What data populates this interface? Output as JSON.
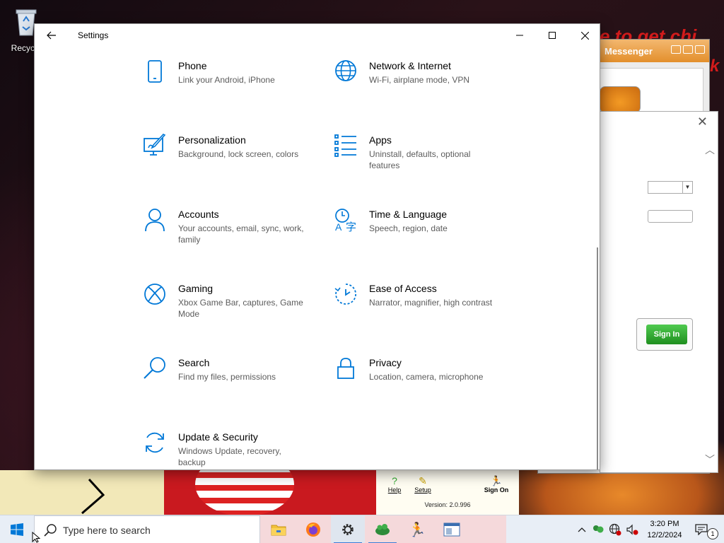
{
  "desktop": {
    "recycle_bin_label": "Recycle",
    "accent": "#0078d7"
  },
  "aim": {
    "title": "Messenger",
    "heading_text": "e to get chi",
    "heading_text_2": "k",
    "sign_in_label": "Sign In",
    "tools": [
      {
        "label": "Help",
        "icon": "help-icon"
      },
      {
        "label": "Setup",
        "icon": "setup-icon"
      },
      {
        "label": "Sign On",
        "icon": "running-man-icon"
      }
    ],
    "version": "Version: 2.0.996"
  },
  "settings": {
    "title": "Settings",
    "tiles": [
      {
        "title": "Phone",
        "desc": "Link your Android, iPhone",
        "icon": "phone-icon"
      },
      {
        "title": "Network & Internet",
        "desc": "Wi-Fi, airplane mode, VPN",
        "icon": "globe-icon"
      },
      {
        "title": "Personalization",
        "desc": "Background, lock screen, colors",
        "icon": "paint-brush-icon"
      },
      {
        "title": "Apps",
        "desc": "Uninstall, defaults, optional features",
        "icon": "apps-list-icon"
      },
      {
        "title": "Accounts",
        "desc": "Your accounts, email, sync, work, family",
        "icon": "person-icon"
      },
      {
        "title": "Time & Language",
        "desc": "Speech, region, date",
        "icon": "time-language-icon"
      },
      {
        "title": "Gaming",
        "desc": "Xbox Game Bar, captures, Game Mode",
        "icon": "xbox-icon"
      },
      {
        "title": "Ease of Access",
        "desc": "Narrator, magnifier, high contrast",
        "icon": "ease-of-access-icon"
      },
      {
        "title": "Search",
        "desc": "Find my files, permissions",
        "icon": "search-icon"
      },
      {
        "title": "Privacy",
        "desc": "Location, camera, microphone",
        "icon": "lock-icon"
      },
      {
        "title": "Update & Security",
        "desc": "Windows Update, recovery, backup",
        "icon": "sync-icon"
      }
    ]
  },
  "taskbar": {
    "search_placeholder": "Type here to search",
    "apps": [
      "file-explorer-icon",
      "firefox-icon",
      "settings-gear-icon",
      "aim-buddy-icon",
      "aim-running-man-icon",
      "app-window-icon"
    ],
    "clock_time": "3:20 PM",
    "clock_date": "12/2/2024",
    "notification_count": "1"
  }
}
